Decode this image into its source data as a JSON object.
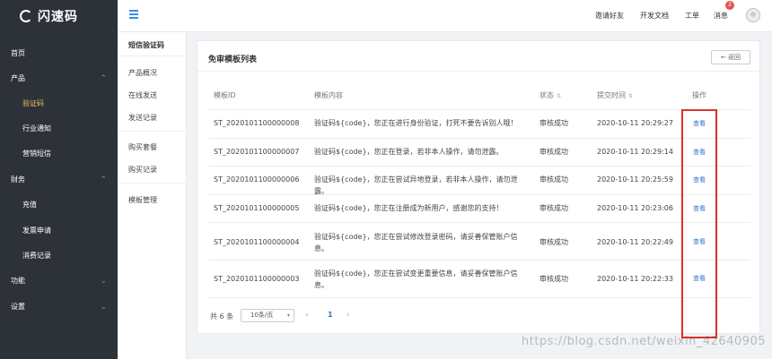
{
  "brand": {
    "name": "闪速码"
  },
  "sidebar": {
    "items": [
      {
        "label": "首页",
        "level": "top",
        "chevron": ""
      },
      {
        "label": "产品",
        "level": "top",
        "chevron": "⌃"
      },
      {
        "label": "验证码",
        "level": "sub",
        "active": true
      },
      {
        "label": "行业通知",
        "level": "sub"
      },
      {
        "label": "营销短信",
        "level": "sub"
      },
      {
        "label": "财务",
        "level": "top",
        "chevron": "⌃"
      },
      {
        "label": "充值",
        "level": "sub"
      },
      {
        "label": "发票申请",
        "level": "sub"
      },
      {
        "label": "消费记录",
        "level": "sub"
      },
      {
        "label": "功能",
        "level": "top",
        "chevron": "⌄"
      },
      {
        "label": "设置",
        "level": "top",
        "chevron": "⌄"
      }
    ]
  },
  "header": {
    "links": [
      "邀请好友",
      "开发文档",
      "工单",
      "消息"
    ],
    "message_badge": "2"
  },
  "submenu": {
    "title": "短信验证码",
    "items": [
      "产品概况",
      "在线发送",
      "发送记录",
      "购买套餐",
      "购买记录",
      "模板管理"
    ]
  },
  "card": {
    "title": "免审模板列表",
    "back_label": "← 返回",
    "columns": [
      "模板ID",
      "模板内容",
      "状态",
      "提交时间",
      "操作"
    ],
    "rows": [
      {
        "id": "ST_2020101100000008",
        "content": "验证码${code}，您正在进行身份验证，打死不要告诉别人哦！",
        "status": "审核成功",
        "time": "2020-10-11 20:29:27",
        "action": "查看"
      },
      {
        "id": "ST_2020101100000007",
        "content": "验证码${code}，您正在登录，若非本人操作，请勿泄露。",
        "status": "审核成功",
        "time": "2020-10-11 20:29:14",
        "action": "查看"
      },
      {
        "id": "ST_2020101100000006",
        "content": "验证码${code}，您正在尝试异地登录，若非本人操作，请勿泄露。",
        "status": "审核成功",
        "time": "2020-10-11 20:25:59",
        "action": "查看"
      },
      {
        "id": "ST_2020101100000005",
        "content": "验证码${code}，您正在注册成为新用户，感谢您的支持！",
        "status": "审核成功",
        "time": "2020-10-11 20:23:06",
        "action": "查看"
      },
      {
        "id": "ST_2020101100000004",
        "content": "验证码${code}，您正在尝试修改登录密码，请妥善保管账户信息。",
        "status": "审核成功",
        "time": "2020-10-11 20:22:49",
        "action": "查看"
      },
      {
        "id": "ST_2020101100000003",
        "content": "验证码${code}，您正在尝试变更重要信息，请妥善保管账户信息。",
        "status": "审核成功",
        "time": "2020-10-11 20:22:33",
        "action": "查看"
      }
    ],
    "pagination": {
      "total": "共 6 条",
      "page_size": "10条/页",
      "current_page": "1"
    }
  },
  "watermark": "https://blog.csdn.net/weixin_42640905"
}
